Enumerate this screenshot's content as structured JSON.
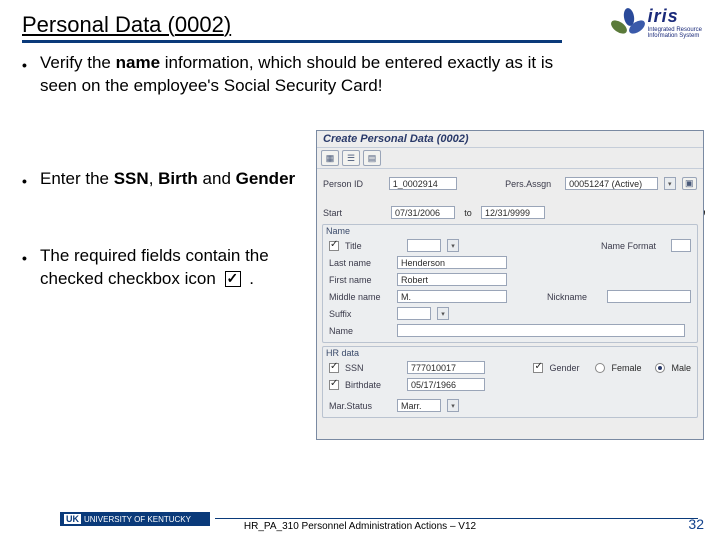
{
  "title": {
    "prefix": "Personal Data (",
    "code": "0002",
    "suffix": ")"
  },
  "logo": {
    "name": "iris",
    "line1": "Integrated Resource",
    "line2": "Information System"
  },
  "bullets": {
    "b1": {
      "pre": "Verify the ",
      "bold": "name",
      "post": " information, which should be entered exactly as it is seen on the employee's Social Security Card!"
    },
    "b2": {
      "pre": "Enter the ",
      "bold1": "SSN",
      "mid": ", ",
      "bold2": "Birth",
      "mid2": " and ",
      "bold3": "Gender"
    },
    "b3": {
      "pre": "The required fields contain the checked checkbox icon",
      "post": "."
    }
  },
  "stray_comma": ",",
  "sap": {
    "win_title": "Create Personal Data (0002)",
    "toolbar": {
      "icons": [
        "grid-icon",
        "person-icon",
        "page-icon"
      ]
    },
    "person_row": {
      "label": "Person ID",
      "value": "1_0002914",
      "assign_label": "Pers.Assgn",
      "assign_value": "00051247 (Active)"
    },
    "date_row": {
      "label": "Start",
      "from": "07/31/2006",
      "to_label": "to",
      "to": "12/31/9999"
    },
    "name_group": {
      "label": "Name",
      "title_label": "Title",
      "title_value": "",
      "format_label": "Name Format",
      "format_value": "",
      "last_label": "Last name",
      "last_value": "Henderson",
      "first_label": "First name",
      "first_value": "Robert",
      "middle_label": "Middle name",
      "middle_value": "M.",
      "nick_label": "Nickname",
      "nick_value": "",
      "suffix_label": "Suffix",
      "suffix_value": "",
      "name_label": "Name",
      "name_value": ""
    },
    "hr_group": {
      "label": "HR data",
      "ssn_label": "SSN",
      "ssn_value": "777010017",
      "gender_label": "Gender",
      "female": "Female",
      "male": "Male",
      "selected": "male",
      "birth_label": "Birthdate",
      "birth_value": "05/17/1966",
      "mar_label": "Mar.Status",
      "mar_value": "Marr."
    }
  },
  "footer": {
    "uk_abbr": "UK",
    "uk_text": "UNIVERSITY OF KENTUCKY",
    "center": "HR_PA_310 Personnel Administration Actions – V12",
    "page": "32"
  }
}
